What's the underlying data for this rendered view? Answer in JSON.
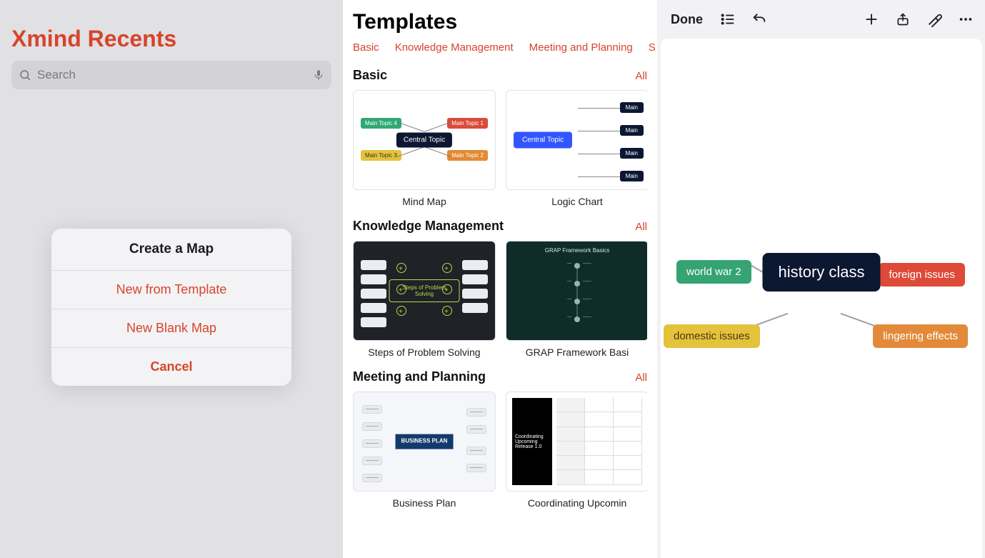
{
  "recents": {
    "title": "Xmind Recents",
    "search_placeholder": "Search",
    "action_sheet": {
      "title": "Create a Map",
      "new_from_template": "New from Template",
      "new_blank_map": "New Blank Map",
      "cancel": "Cancel"
    }
  },
  "templates": {
    "title": "Templates",
    "tabs": {
      "basic": "Basic",
      "knowledge": "Knowledge Management",
      "meeting": "Meeting and Planning",
      "s_trunc": "S"
    },
    "all_label": "All",
    "sections": {
      "basic": {
        "title": "Basic",
        "cards": {
          "mindmap": {
            "label": "Mind Map",
            "center": "Central Topic",
            "t1": "Main Topic 1",
            "t2": "Main Topic 2",
            "t3": "Main Topic 3",
            "t4": "Main Topic 4"
          },
          "logic": {
            "label": "Logic Chart",
            "center": "Central Topic",
            "leaf": "Main"
          }
        }
      },
      "knowledge": {
        "title": "Knowledge Management",
        "cards": {
          "steps": {
            "label": "Steps of Problem Solving",
            "center": "Steps of Problem Solving"
          },
          "grap": {
            "label": "GRAP Framework Basi",
            "thumb_title": "GRAP Framework Basics"
          }
        }
      },
      "meeting": {
        "title": "Meeting and Planning",
        "cards": {
          "bp": {
            "label": "Business Plan",
            "center": "BUSINESS PLAN"
          },
          "coord": {
            "label": "Coordinating Upcomin",
            "side": "Coordinating Upcoming Release 1.0"
          }
        }
      }
    }
  },
  "editor": {
    "done": "Done",
    "map": {
      "root": "history class",
      "ww2": "world war 2",
      "domestic": "domestic issues",
      "foreign": "foreign issues",
      "lingering": "lingering effects"
    }
  }
}
